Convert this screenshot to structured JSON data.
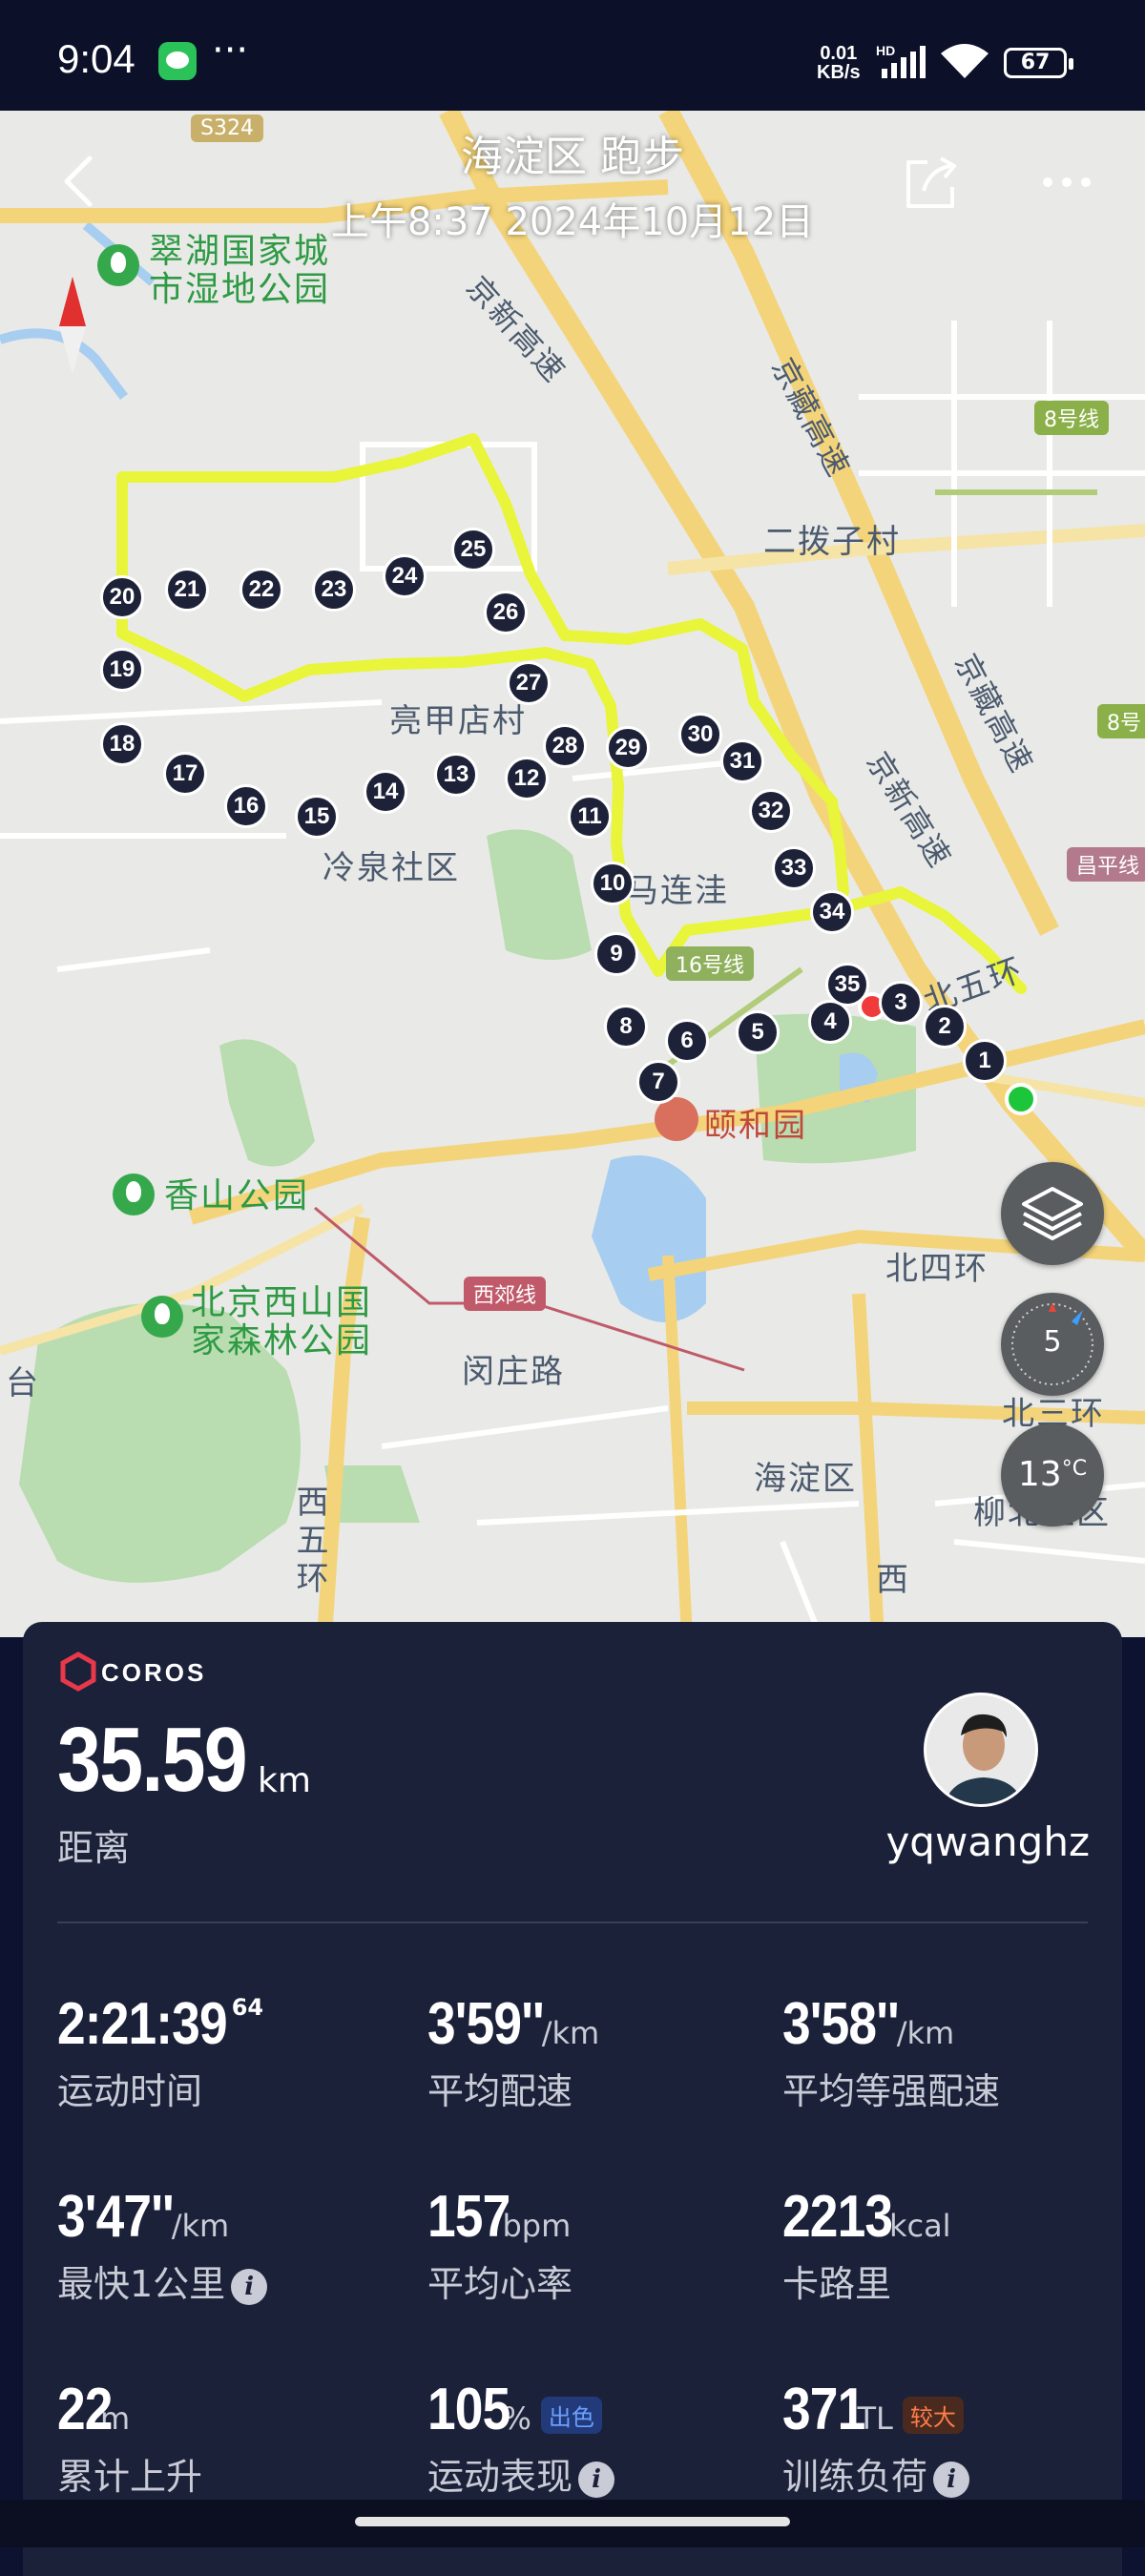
{
  "status_bar": {
    "time": "9:04",
    "speed_top": "0.01",
    "speed_unit": "KB/s",
    "network": "HD",
    "battery": "67",
    "icons": [
      "wechat-icon",
      "more-dots-icon",
      "signal-icon",
      "wifi-icon",
      "battery-icon"
    ]
  },
  "header": {
    "title": "海淀区 跑步",
    "subtitle": "上午8:37 2024年10月12日",
    "icons": [
      "back-arrow-icon",
      "share-icon",
      "more-icon"
    ]
  },
  "map": {
    "labels": {
      "s324": "S324",
      "cuihu": "翠湖国家城\n市湿地公园",
      "jingxin1": "京新高速",
      "jingzang1": "京藏高速",
      "line8": "8号线",
      "erbozi": "二拨子村",
      "jingzang2": "京藏高速",
      "line8b": "8号",
      "liangjiadian": "亮甲店村",
      "jingxin2": "京新高速",
      "changping": "昌平线",
      "lengquan": "冷泉社区",
      "malianwa": "马连洼",
      "line16": "16号线",
      "north5": "北五环",
      "yiheyuan": "颐和园",
      "xiangshan": "香山公园",
      "north4": "北四环",
      "xijiao": "西郊线",
      "xishan": "北京西山国\n家森林公园",
      "minzhuang": "闵庄路",
      "tai": "台",
      "north3": "北三环",
      "haidian": "海淀区",
      "liubei": "柳北社区",
      "west5": "西五环",
      "west": "西"
    },
    "route_km_markers": [
      "1",
      "2",
      "3",
      "4",
      "5",
      "6",
      "7",
      "8",
      "9",
      "10",
      "11",
      "12",
      "13",
      "14",
      "15",
      "16",
      "17",
      "18",
      "19",
      "20",
      "21",
      "22",
      "23",
      "24",
      "25",
      "26",
      "27",
      "28",
      "29",
      "30",
      "31",
      "32",
      "33",
      "34",
      "35"
    ],
    "controls": {
      "wind_level": "5",
      "temperature": "13",
      "temperature_unit": "°C",
      "icons": [
        "layers-icon",
        "wind-compass-icon",
        "north-arrow-icon"
      ]
    }
  },
  "summary": {
    "brand": "COROS",
    "distance_value": "35.59",
    "distance_unit": "km",
    "distance_label": "距离",
    "username": "yqwanghz"
  },
  "stats": [
    {
      "value": "2:21:39",
      "sup": "64",
      "unit": "",
      "label": "运动时间"
    },
    {
      "value": "3'59''",
      "unit": "/km",
      "label": "平均配速"
    },
    {
      "value": "3'58''",
      "unit": "/km",
      "label": "平均等强配速"
    },
    {
      "value": "3'47''",
      "unit": "/km",
      "label": "最快1公里"
    },
    {
      "value": "157",
      "unit": "bpm",
      "label": "平均心率"
    },
    {
      "value": "2213",
      "unit": "kcal",
      "label": "卡路里"
    },
    {
      "value": "22",
      "unit": "m",
      "label": "累计上升"
    },
    {
      "value": "105",
      "unit": "%",
      "label": "运动表现",
      "tag": "出色"
    },
    {
      "value": "371",
      "unit": "TL",
      "label": "训练负荷",
      "tag": "较大"
    }
  ],
  "colors": {
    "route": "#e8f53a",
    "card_bg": "#1c213a",
    "start": "#1dc53a",
    "end": "#f03b3b",
    "tag_blue": "#6aa0ff",
    "tag_orange": "#ff7d4a"
  }
}
